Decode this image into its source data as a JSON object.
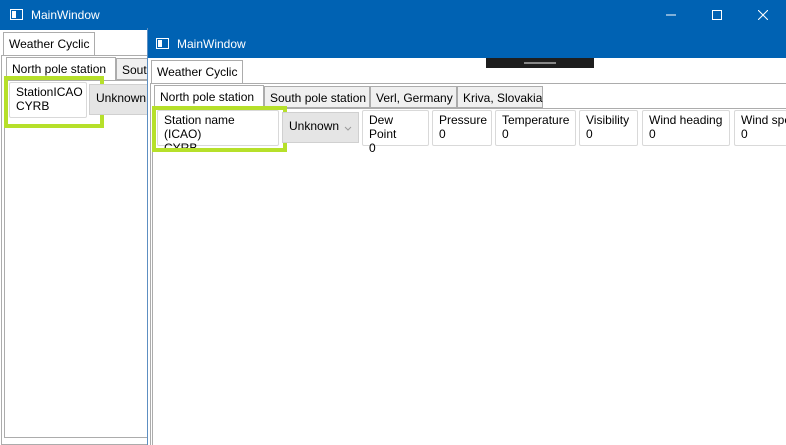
{
  "back_window": {
    "title": "MainWindow",
    "tab": "Weather Cyclic",
    "station_tabs": [
      "North pole station",
      "South"
    ],
    "station_field": {
      "label": "StationICAO",
      "value": "CYRB"
    },
    "combo_value": "Unknown"
  },
  "front_window": {
    "title": "MainWindow",
    "tab": "Weather Cyclic",
    "station_tabs": [
      "North pole station",
      "South pole station",
      "Verl, Germany",
      "Kriva, Slovakia"
    ],
    "station_field": {
      "label": "Station name (ICAO)",
      "value": "CYRB"
    },
    "combo_value": "Unknown",
    "fields": [
      {
        "label": "Dew Point",
        "value": "0"
      },
      {
        "label": "Pressure",
        "value": "0"
      },
      {
        "label": "Temperature",
        "value": "0"
      },
      {
        "label": "Visibility",
        "value": "0"
      },
      {
        "label": "Wind heading",
        "value": "0"
      },
      {
        "label": "Wind spe",
        "value": "0"
      }
    ]
  },
  "colors": {
    "titlebar": "#0062b3",
    "highlight": "#b6e02a"
  },
  "icons": [
    "window-app-icon",
    "minimize-icon",
    "maximize-icon",
    "close-icon",
    "chevron-down-icon"
  ]
}
